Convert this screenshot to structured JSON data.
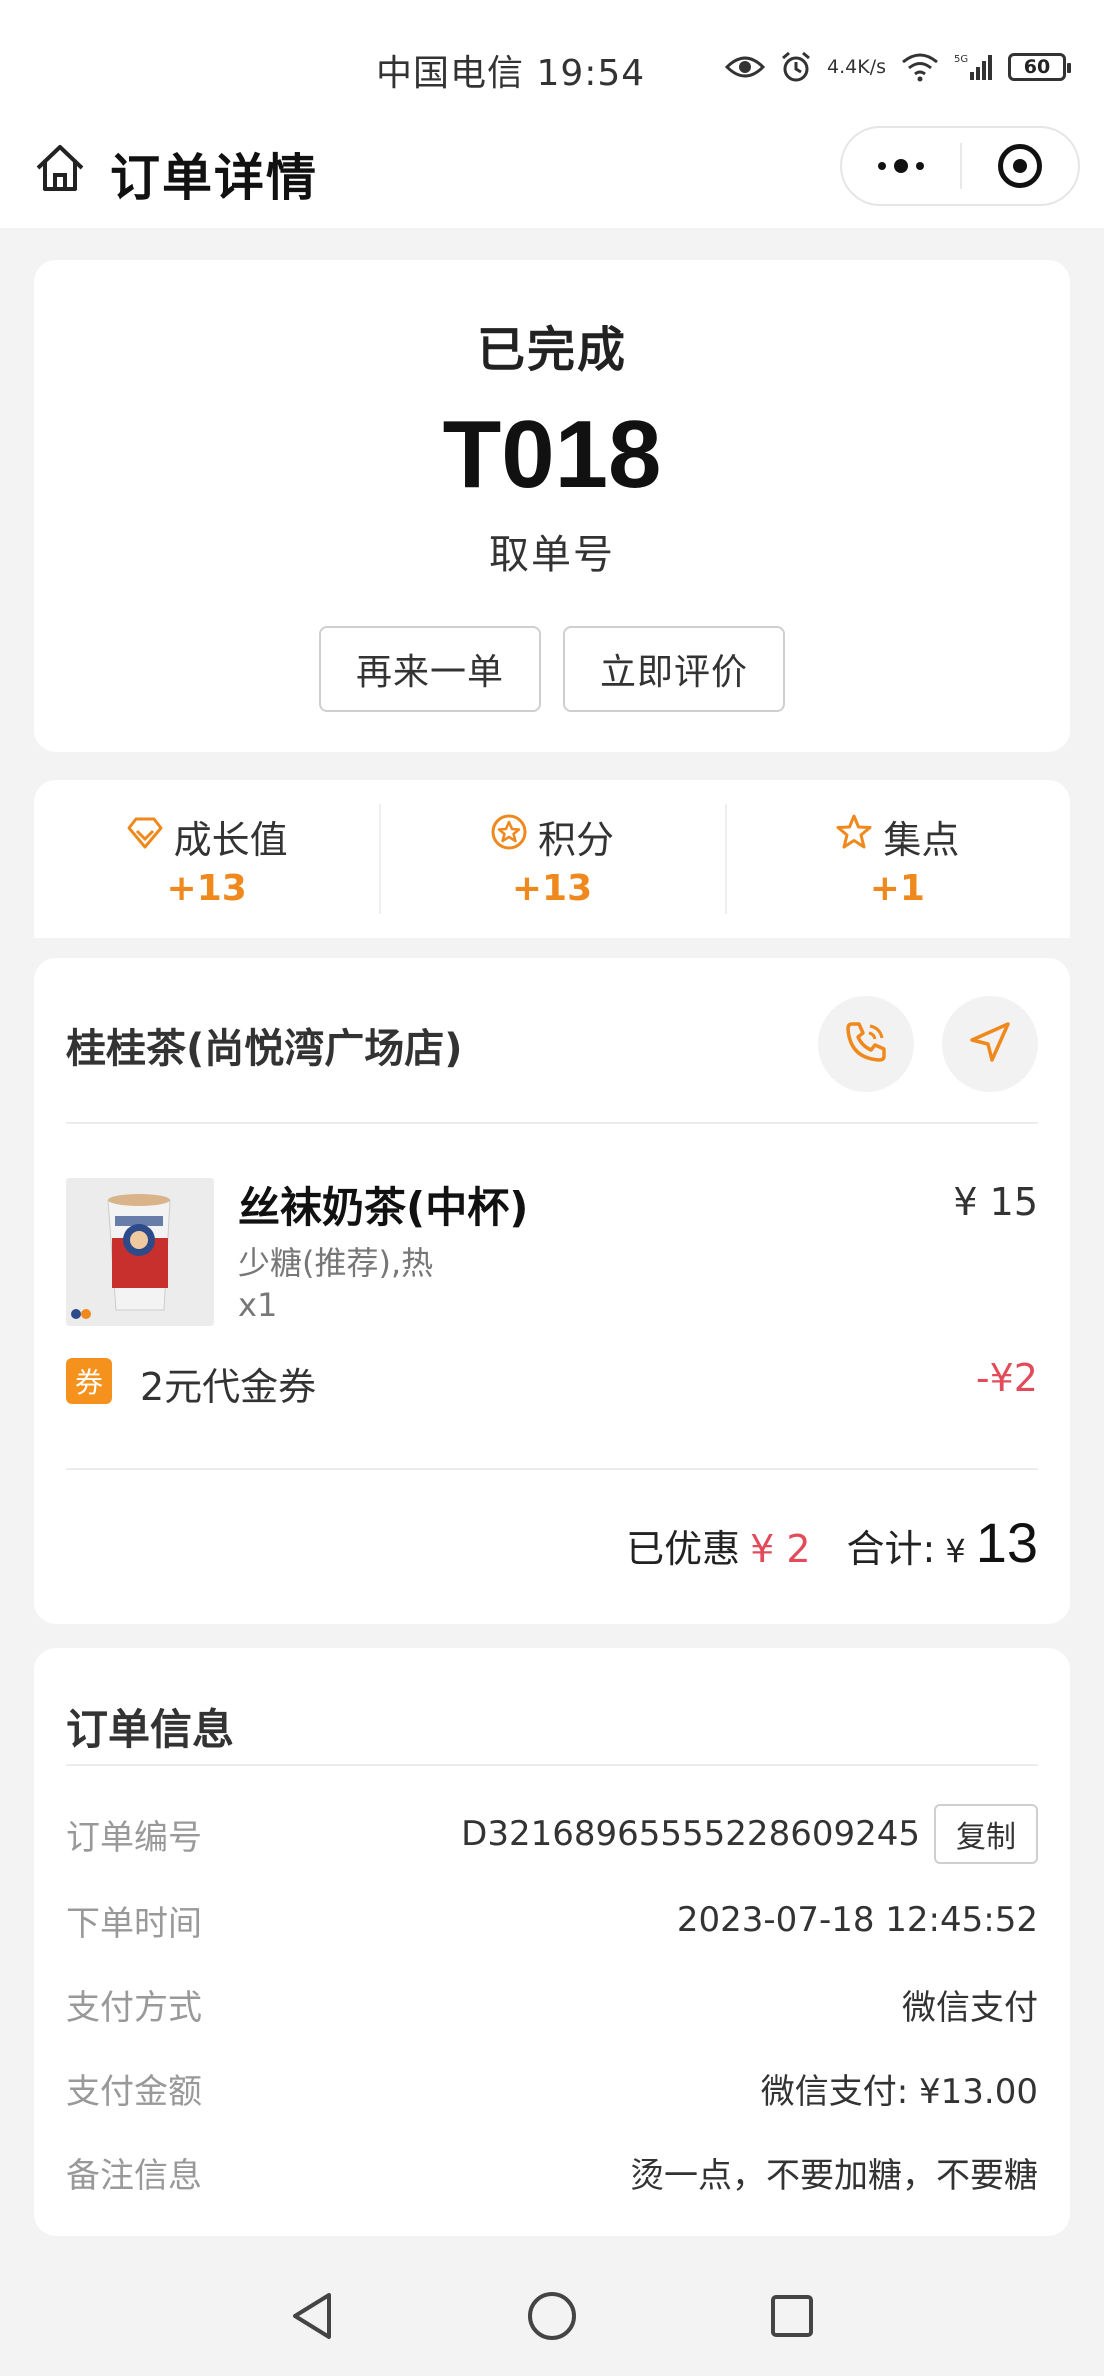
{
  "status_bar": {
    "carrier_time": "中国电信 19:54",
    "net_speed_top": "4.4",
    "net_speed_bottom": "K/s",
    "battery": "60"
  },
  "header": {
    "title": "订单详情"
  },
  "order": {
    "status": "已完成",
    "pickup_number": "T018",
    "pickup_label": "取单号",
    "reorder_button": "再来一单",
    "review_button": "立即评价"
  },
  "rewards": [
    {
      "label": "成长值",
      "value": "+13",
      "icon": "diamond-icon"
    },
    {
      "label": "积分",
      "value": "+13",
      "icon": "points-star-icon"
    },
    {
      "label": "集点",
      "value": "+1",
      "icon": "star-icon"
    }
  ],
  "store": {
    "name": "桂桂茶(尚悦湾广场店)"
  },
  "item": {
    "name": "丝袜奶茶(中杯)",
    "spec": "少糖(推荐),热",
    "qty": "x1",
    "price": "¥ 15"
  },
  "coupon": {
    "badge": "券",
    "name": "2元代金券",
    "value": "-¥2"
  },
  "totals": {
    "discount_label": "已优惠",
    "discount_value": "¥ 2",
    "total_label": "合计:",
    "currency": "¥",
    "total_value": "13"
  },
  "order_info": {
    "title": "订单信息",
    "copy_button": "复制",
    "rows": [
      {
        "key": "订单编号",
        "value": "D3216896555522860924​5"
      },
      {
        "key": "下单时间",
        "value": "2023-07-18 12:45:52"
      },
      {
        "key": "支付方式",
        "value": "微信支付"
      },
      {
        "key": "支付金额",
        "value": "微信支付: ¥13.00"
      },
      {
        "key": "备注信息",
        "value": "烫一点，不要加糖，不要糖"
      }
    ]
  },
  "colors": {
    "accent": "#f0891d",
    "price_red": "#e24c5a",
    "coupon_orange": "#f5921e"
  }
}
